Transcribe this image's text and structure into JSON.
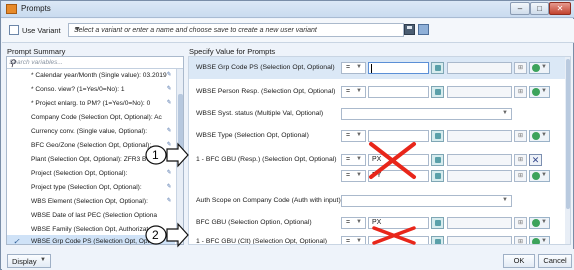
{
  "window": {
    "title": "Prompts"
  },
  "variant": {
    "use_variant_label": "Use Variant",
    "field_text": "Select a variant or enter a name and choose save to create a new user variant"
  },
  "headers": {
    "left": "Prompt Summary",
    "right": "Specify Value for Prompts"
  },
  "search": {
    "placeholder": "Search variables..."
  },
  "summary_items": [
    {
      "label": "* Calendar year/Month (Single value): 03.2019"
    },
    {
      "label": "* Conso. view? (1=Yes/0=No): 1"
    },
    {
      "label": "* Project enlarg. to PM? (1=Yes/0=No): 0"
    },
    {
      "label": "Company Code (Selection Opt, Optional): Ac"
    },
    {
      "label": "Currency conv. (Single value, Optional):"
    },
    {
      "label": "BFC Geo/Zone (Selection Opt, Optional):"
    },
    {
      "label": "Plant (Selection Opt, Optional): ZFR3 Be"
    },
    {
      "label": "Project (Selection Opt, Optional):"
    },
    {
      "label": "Project type (Selection Opt, Optional):"
    },
    {
      "label": "WBS Element (Selection Opt, Optional):"
    },
    {
      "label": "WBSE Date of last PEC (Selection Optiona"
    },
    {
      "label": "WBSE Family (Selection Opt, Authorizat"
    },
    {
      "label": "WBSE Grp Code PS (Selection Opt, Opt"
    }
  ],
  "prompts": [
    {
      "label": "WBSE Grp Code PS (Selection Opt, Optional)",
      "op": "=",
      "value": ""
    },
    {
      "label": "WBSE Person Resp. (Selection Opt, Optional)",
      "op": "=",
      "value": ""
    },
    {
      "label": "WBSE Syst. status (Multiple Val, Optional)"
    },
    {
      "label": "WBSE Type (Selection Opt, Optional)",
      "op": "=",
      "value": ""
    },
    {
      "label": "1 - BFC GBU (Resp.) (Selection Opt, Optional)",
      "op": "=",
      "value": "PX"
    },
    {
      "label": "",
      "op": "=",
      "value": "PY"
    },
    {
      "label": "Auth Scope on Company Code (Auth with input)"
    },
    {
      "label": "BFC GBU (Selection Option, Optional)",
      "op": "=",
      "value": "PX"
    },
    {
      "label": "1 - BFC GBU (Clt) (Selection Opt, Optional)",
      "op": "=",
      "value": ""
    }
  ],
  "annotations": {
    "callout_1": "1",
    "callout_2": "2"
  },
  "footer": {
    "display": "Display",
    "ok": "OK",
    "cancel": "Cancel"
  },
  "colors": {
    "cross": "#e8261a",
    "selected_row": "#dbe8f6",
    "accent": "#3ca35b"
  }
}
